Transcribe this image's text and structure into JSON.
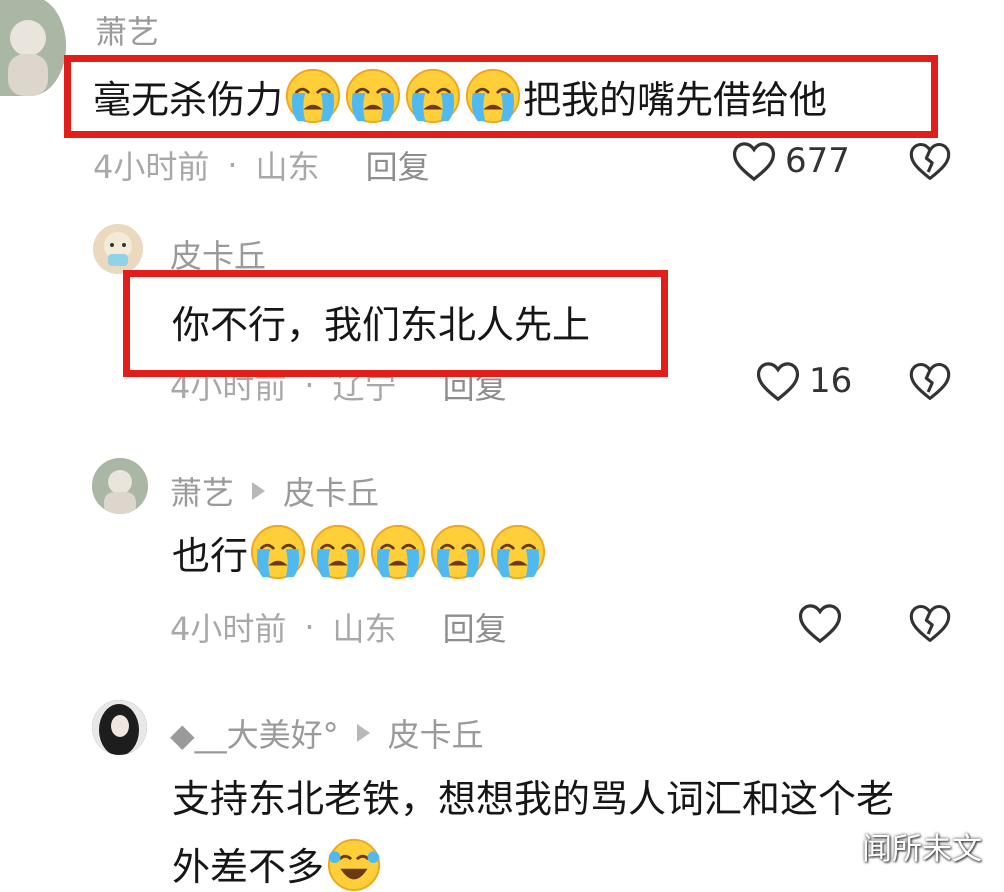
{
  "comments": [
    {
      "user": "萧艺",
      "text_before": "毫无杀伤力",
      "emoji_count": 4,
      "text_after": "把我的嘴先借给他",
      "time": "4小时前",
      "location": "山东",
      "reply_label": "回复",
      "likes": "677"
    },
    {
      "user": "皮卡丘",
      "text": "你不行，我们东北人先上",
      "time": "4小时前",
      "location": "辽宁",
      "reply_label": "回复",
      "likes": "16"
    },
    {
      "user": "萧艺",
      "reply_to": "皮卡丘",
      "text": "也行",
      "emoji_count": 5,
      "time": "4小时前",
      "location": "山东",
      "reply_label": "回复"
    },
    {
      "user": "◆__大美好°",
      "reply_to": "皮卡丘",
      "text_line1": "支持东北老铁，想想我的骂人词汇和这个老",
      "text_line2": "外差不多"
    }
  ],
  "separator": "·",
  "watermark": "闻所未文",
  "colors": {
    "highlight": "#e21e1b",
    "meta": "#a8a8a8",
    "name": "#9a9a9a"
  },
  "icons": {
    "like": "heart-outline-icon",
    "dislike": "broken-heart-icon",
    "cry": "crying-emoji-icon",
    "laugh": "laugh-tears-emoji-icon"
  }
}
